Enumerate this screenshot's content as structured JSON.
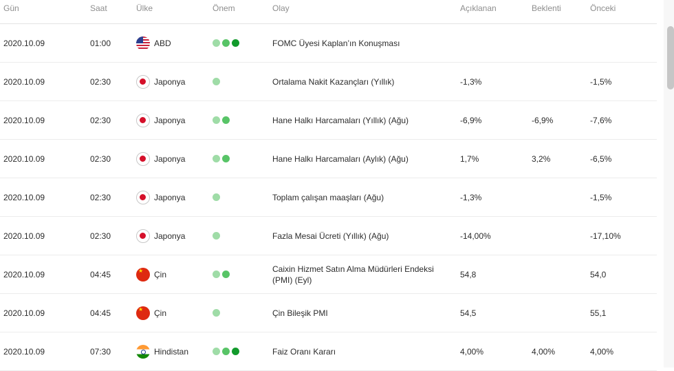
{
  "headers": {
    "date": "Gün",
    "time": "Saat",
    "country": "Ülke",
    "importance": "Önem",
    "event": "Olay",
    "actual": "Açıklanan",
    "forecast": "Beklenti",
    "previous": "Önceki"
  },
  "importance_colors": [
    "#9fdca7",
    "#58c467",
    "#129a2c"
  ],
  "rows": [
    {
      "date": "2020.10.09",
      "time": "01:00",
      "country": "ABD",
      "flag": "us-flag-icon",
      "importance": 3,
      "event": "FOMC Üyesi Kaplan’ın Konuşması",
      "actual": "",
      "forecast": "",
      "previous": ""
    },
    {
      "date": "2020.10.09",
      "time": "02:30",
      "country": "Japonya",
      "flag": "japan-flag-icon",
      "importance": 1,
      "event": "Ortalama Nakit Kazançları (Yıllık)",
      "actual": "-1,3%",
      "forecast": "",
      "previous": "-1,5%"
    },
    {
      "date": "2020.10.09",
      "time": "02:30",
      "country": "Japonya",
      "flag": "japan-flag-icon",
      "importance": 2,
      "event": "Hane Halkı Harcamaları (Yıllık) (Ağu)",
      "actual": "-6,9%",
      "forecast": "-6,9%",
      "previous": "-7,6%"
    },
    {
      "date": "2020.10.09",
      "time": "02:30",
      "country": "Japonya",
      "flag": "japan-flag-icon",
      "importance": 2,
      "event": "Hane Halkı Harcamaları (Aylık) (Ağu)",
      "actual": "1,7%",
      "forecast": "3,2%",
      "previous": "-6,5%"
    },
    {
      "date": "2020.10.09",
      "time": "02:30",
      "country": "Japonya",
      "flag": "japan-flag-icon",
      "importance": 1,
      "event": "Toplam çalışan maaşları (Ağu)",
      "actual": "-1,3%",
      "forecast": "",
      "previous": "-1,5%"
    },
    {
      "date": "2020.10.09",
      "time": "02:30",
      "country": "Japonya",
      "flag": "japan-flag-icon",
      "importance": 1,
      "event": "Fazla Mesai Ücreti (Yıllık) (Ağu)",
      "actual": "-14,00%",
      "forecast": "",
      "previous": "-17,10%"
    },
    {
      "date": "2020.10.09",
      "time": "04:45",
      "country": "Çin",
      "flag": "china-flag-icon",
      "importance": 2,
      "event": "Caixin Hizmet Satın Alma Müdürleri Endeksi (PMI) (Eyl)",
      "actual": "54,8",
      "forecast": "",
      "previous": "54,0"
    },
    {
      "date": "2020.10.09",
      "time": "04:45",
      "country": "Çin",
      "flag": "china-flag-icon",
      "importance": 1,
      "event": "Çin Bileşik PMI",
      "actual": "54,5",
      "forecast": "",
      "previous": "55,1"
    },
    {
      "date": "2020.10.09",
      "time": "07:30",
      "country": "Hindistan",
      "flag": "india-flag-icon",
      "importance": 3,
      "event": "Faiz Oranı Kararı",
      "actual": "4,00%",
      "forecast": "4,00%",
      "previous": "4,00%"
    }
  ]
}
